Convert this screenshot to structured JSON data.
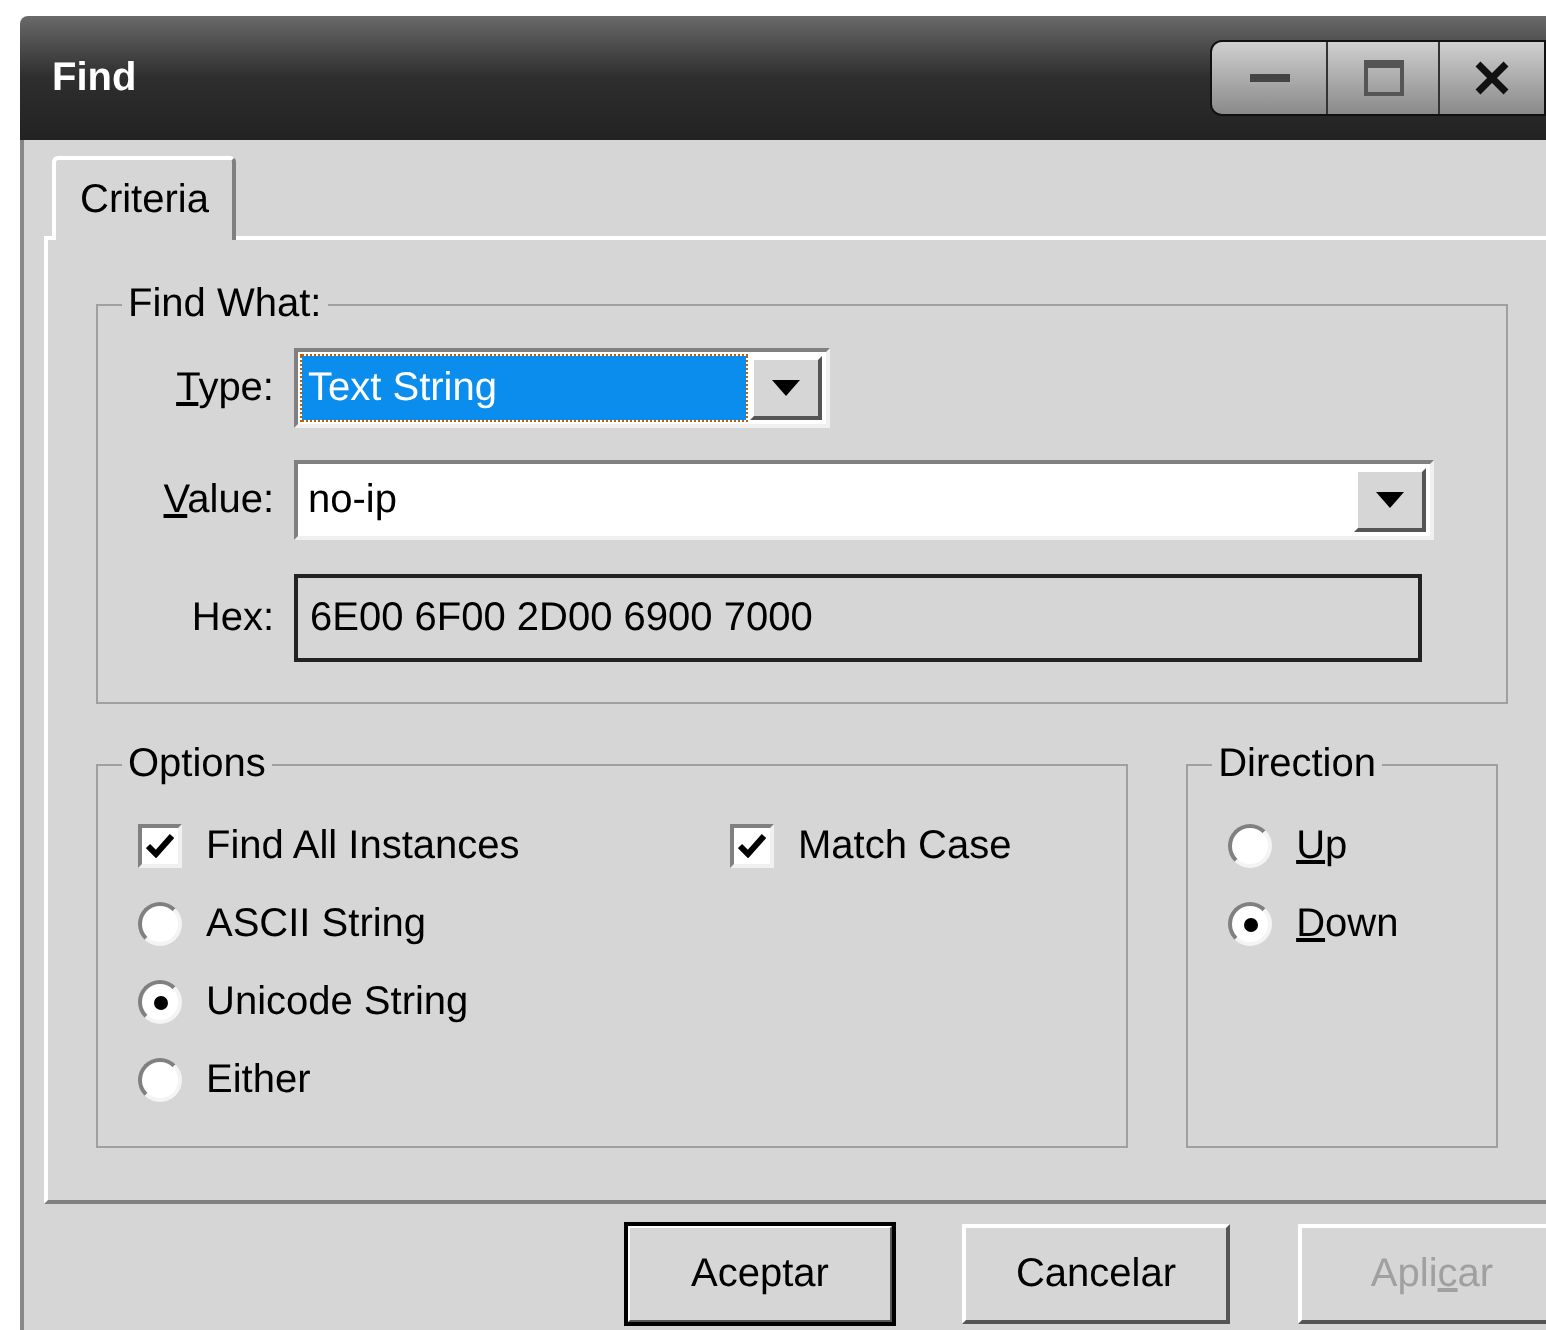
{
  "window": {
    "title": "Find"
  },
  "tabs": [
    {
      "label": "Criteria",
      "selected": true
    }
  ],
  "find_what": {
    "title": "Find What:",
    "fields": [
      {
        "kind": "combo",
        "label": [
          {
            "text": "T",
            "underline": true
          },
          {
            "text": "ype:",
            "underline": false
          }
        ],
        "value": "Text String",
        "focused": true
      },
      {
        "kind": "combo",
        "label": [
          {
            "text": "V",
            "underline": true
          },
          {
            "text": "alue:",
            "underline": false
          }
        ],
        "value": "no-ip",
        "focused": false
      },
      {
        "kind": "readonly",
        "label": [
          {
            "text": "Hex:",
            "underline": false
          }
        ],
        "value": "6E00 6F00 2D00 6900 7000"
      }
    ]
  },
  "options": {
    "title": "Options",
    "items": [
      {
        "kind": "checkbox",
        "label": "Find All Instances",
        "checked": true
      },
      {
        "kind": "checkbox",
        "label": "Match Case",
        "checked": true
      },
      {
        "kind": "radio",
        "label": "ASCII String",
        "selected": false
      },
      {
        "kind": "radio",
        "label": "Unicode String",
        "selected": true
      },
      {
        "kind": "radio",
        "label": "Either",
        "selected": false
      }
    ]
  },
  "direction": {
    "title": "Direction",
    "items": [
      {
        "label": [
          {
            "text": "U",
            "underline": true
          },
          {
            "text": "p",
            "underline": false
          }
        ],
        "selected": false
      },
      {
        "label": [
          {
            "text": "D",
            "underline": true
          },
          {
            "text": "own",
            "underline": false
          }
        ],
        "selected": true
      }
    ]
  },
  "buttons": [
    {
      "label": [
        {
          "text": "Aceptar",
          "underline": false
        }
      ],
      "default": true,
      "disabled": false
    },
    {
      "label": [
        {
          "text": "Cancelar",
          "underline": false
        }
      ],
      "default": false,
      "disabled": false
    },
    {
      "label": [
        {
          "text": "Apli",
          "underline": false
        },
        {
          "text": "c",
          "underline": true
        },
        {
          "text": "ar",
          "underline": false
        }
      ],
      "default": false,
      "disabled": true
    }
  ]
}
